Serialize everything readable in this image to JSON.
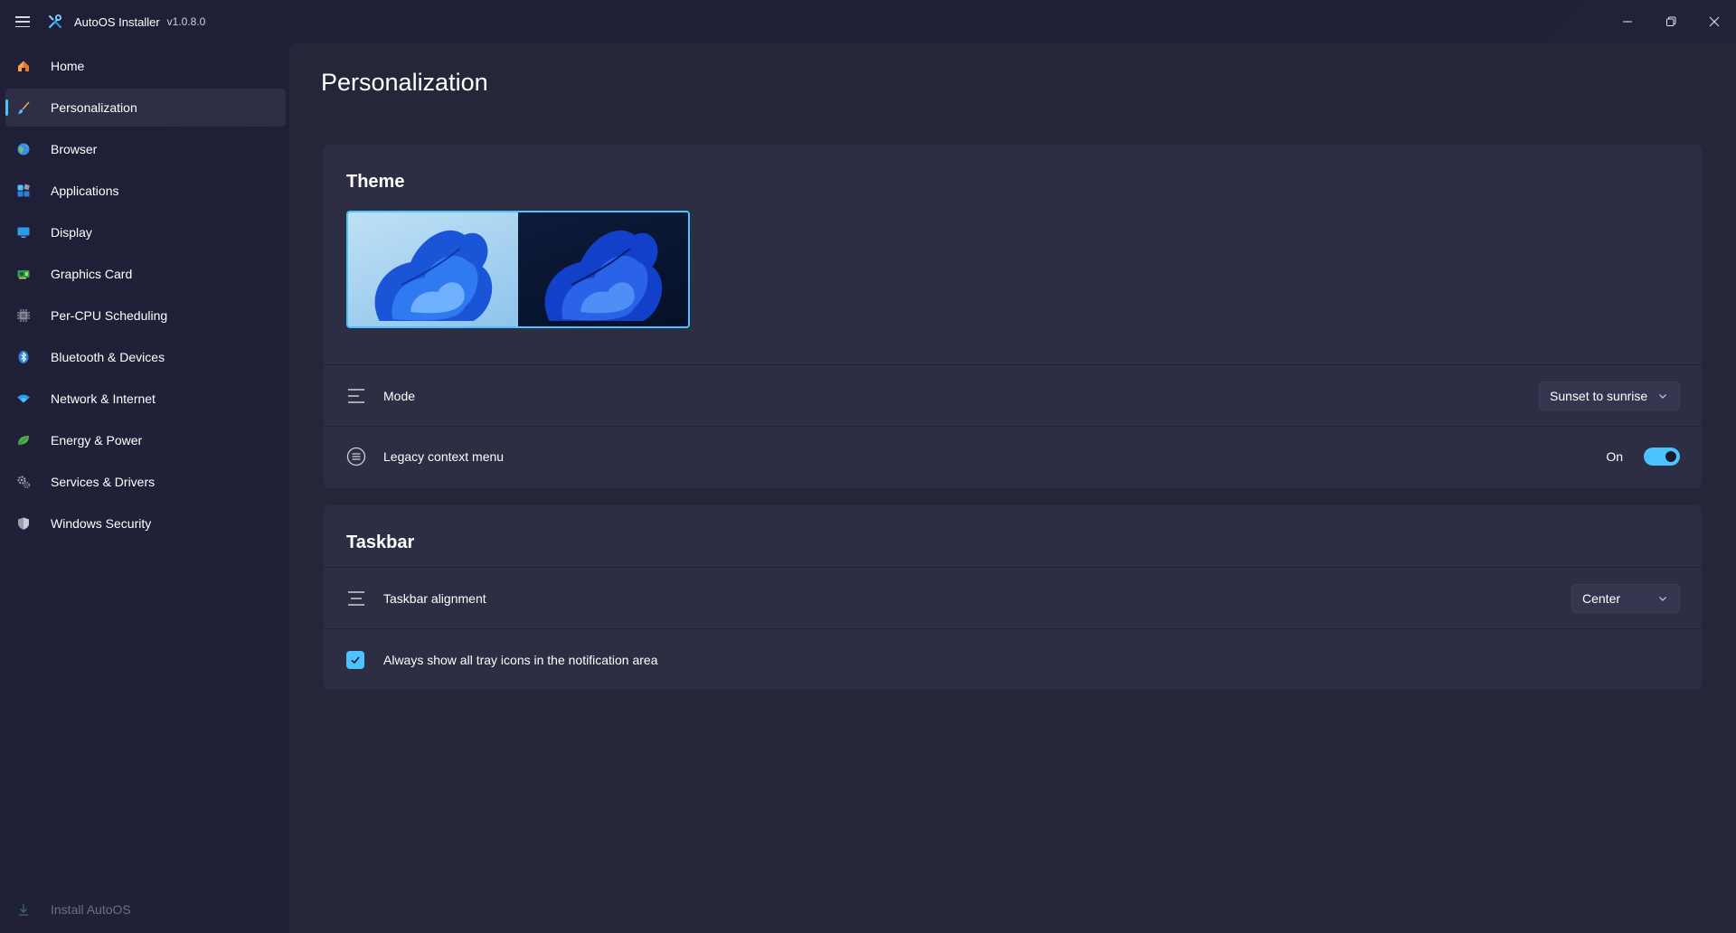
{
  "app": {
    "title": "AutoOS Installer",
    "version": "v1.0.8.0",
    "accent_color": "#4cc2ff"
  },
  "window_controls": {
    "minimize_icon": "minimize-icon",
    "maximize_icon": "restore-icon",
    "close_icon": "close-icon"
  },
  "sidebar": {
    "items": [
      {
        "label": "Home",
        "icon": "home-icon"
      },
      {
        "label": "Personalization",
        "icon": "paintbrush-icon",
        "active": true
      },
      {
        "label": "Browser",
        "icon": "globe-icon"
      },
      {
        "label": "Applications",
        "icon": "apps-icon"
      },
      {
        "label": "Display",
        "icon": "monitor-icon"
      },
      {
        "label": "Graphics Card",
        "icon": "gpu-icon"
      },
      {
        "label": "Per-CPU Scheduling",
        "icon": "cpu-icon"
      },
      {
        "label": "Bluetooth & Devices",
        "icon": "bluetooth-icon"
      },
      {
        "label": "Network & Internet",
        "icon": "wifi-icon"
      },
      {
        "label": "Energy & Power",
        "icon": "battery-icon"
      },
      {
        "label": "Services & Drivers",
        "icon": "gears-icon"
      },
      {
        "label": "Windows Security",
        "icon": "shield-icon"
      }
    ],
    "footer": {
      "label": "Install AutoOS",
      "icon": "download-icon"
    }
  },
  "page": {
    "title": "Personalization"
  },
  "theme_card": {
    "title": "Theme",
    "mode": {
      "label": "Mode",
      "value": "Sunset to sunrise"
    },
    "legacy_context_menu": {
      "label": "Legacy context menu",
      "state_label": "On",
      "enabled": true
    }
  },
  "taskbar_card": {
    "title": "Taskbar",
    "alignment": {
      "label": "Taskbar alignment",
      "value": "Center"
    },
    "tray_icons": {
      "label": "Always show all tray icons in the notification area",
      "checked": true
    }
  }
}
